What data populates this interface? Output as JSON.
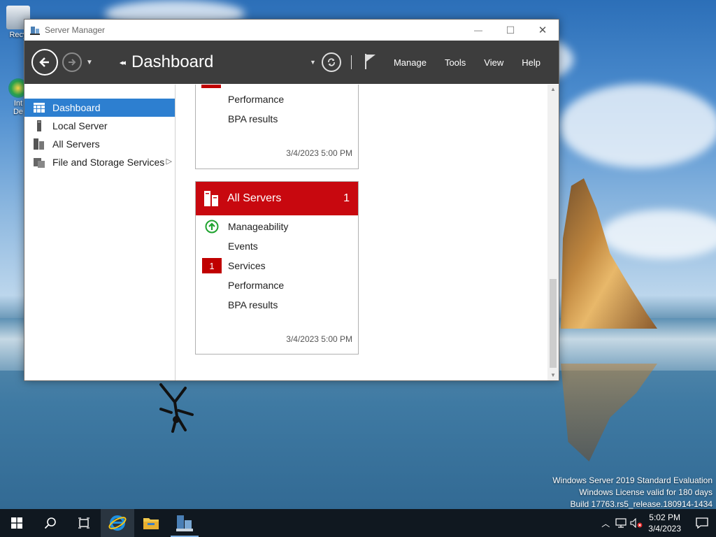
{
  "desktop": {
    "icons": [
      {
        "label": "Recy",
        "icon": "recycle-bin-icon"
      },
      {
        "label": "Int\nDe",
        "icon": "internet-explorer-desktop-icon"
      }
    ],
    "watermark": {
      "line1": "Windows Server 2019 Standard Evaluation",
      "line2": "Windows License valid for 180 days",
      "line3": "Build 17763.rs5_release.180914-1434"
    }
  },
  "window": {
    "title": "Server Manager",
    "controls": {
      "minimize": "—",
      "maximize": "☐",
      "close": "✕"
    }
  },
  "toolbar": {
    "breadcrumb_arrows": "◂◂",
    "breadcrumb": "Dashboard",
    "menu": [
      "Manage",
      "Tools",
      "View",
      "Help"
    ]
  },
  "sidebar": {
    "items": [
      {
        "label": "Dashboard",
        "icon": "dashboard-grid-icon",
        "active": true
      },
      {
        "label": "Local Server",
        "icon": "server-icon",
        "active": false
      },
      {
        "label": "All Servers",
        "icon": "servers-icon",
        "active": false
      },
      {
        "label": "File and Storage Services",
        "icon": "file-storage-icon",
        "active": false,
        "has_submenu": true
      }
    ]
  },
  "tiles": [
    {
      "partial": true,
      "rows": [
        {
          "label": "Performance"
        },
        {
          "label": "BPA results"
        }
      ],
      "timestamp": "3/4/2023 5:00 PM"
    },
    {
      "title": "All Servers",
      "count": "1",
      "header_color": "#c8080f",
      "rows": [
        {
          "label": "Manageability",
          "status": "up-arrow-ok-icon"
        },
        {
          "label": "Events"
        },
        {
          "label": "Services",
          "badge": "1"
        },
        {
          "label": "Performance"
        },
        {
          "label": "BPA results"
        }
      ],
      "timestamp": "3/4/2023 5:00 PM"
    }
  ],
  "taskbar": {
    "buttons": [
      "start-icon",
      "search-icon",
      "task-view-icon",
      "internet-explorer-icon",
      "file-explorer-icon",
      "server-manager-icon"
    ],
    "clock": {
      "time": "5:02 PM",
      "date": "3/4/2023"
    }
  },
  "colors": {
    "accent": "#2d7fd0",
    "tile_red": "#c8080f",
    "badge_red": "#c00000",
    "toolbar_bg": "#3d3d3d",
    "taskbar_bg": "#101820"
  }
}
